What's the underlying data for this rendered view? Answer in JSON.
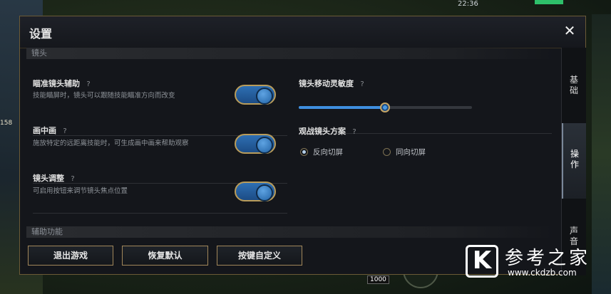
{
  "modal": {
    "title": "设置",
    "close_icon": "close-icon"
  },
  "sections": {
    "camera_header": "镜头",
    "assist_header": "辅助功能"
  },
  "settings": {
    "aim_assist": {
      "label": "瞄准镜头辅助",
      "help": "?",
      "desc": "技能瞄屏时，镜头可以跟随技能瞄准方向而改变",
      "enabled": true
    },
    "pip": {
      "label": "画中画",
      "help": "?",
      "desc": "施放特定的远距离技能时，可生成画中画来帮助观察",
      "enabled": true
    },
    "camera_adjust": {
      "label": "镜头调整",
      "help": "?",
      "desc": "可启用按钮来调节镜头焦点位置",
      "enabled": true
    },
    "sensitivity": {
      "label": "镜头移动灵敏度",
      "help": "?",
      "value": 0.5
    },
    "spectator": {
      "label": "观战镜头方案",
      "help": "?",
      "options": [
        {
          "label": "反向切屏",
          "selected": true
        },
        {
          "label": "同向切屏",
          "selected": false
        }
      ]
    }
  },
  "tabs": [
    {
      "label": "基础",
      "active": false
    },
    {
      "label": "操作",
      "active": true
    },
    {
      "label": "声音",
      "active": false
    }
  ],
  "footer": {
    "quit": "退出游戏",
    "reset": "恢复默认",
    "keys": "按键自定义"
  },
  "background": {
    "time": "22:36",
    "gold": "158",
    "ward_count": "1000"
  },
  "watermark": {
    "logo": "K",
    "text": "参考之家",
    "url": "www.ckdzb.com"
  },
  "colors": {
    "accent_gold": "#b99c5a",
    "toggle_blue": "#2e6fb3"
  }
}
